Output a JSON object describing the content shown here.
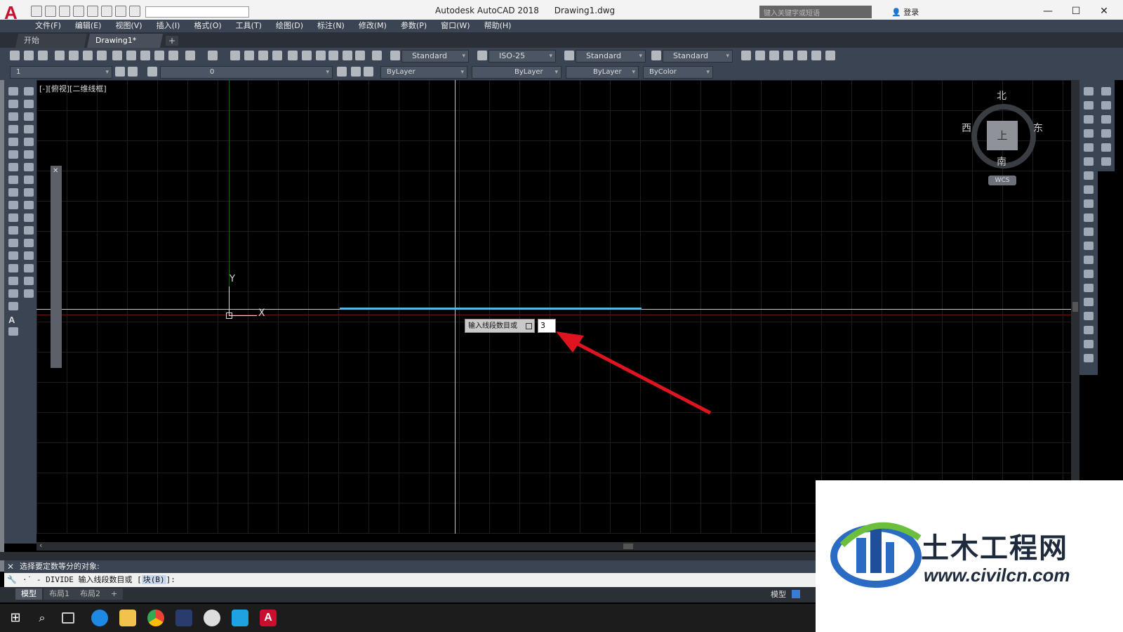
{
  "titlebar": {
    "app_logo": "A",
    "app_name": "Autodesk AutoCAD 2018",
    "doc_name": "Drawing1.dwg",
    "search_placeholder": "键入关键字或短语",
    "login_label": "登录",
    "minimize": "—",
    "maximize": "☐",
    "close": "✕"
  },
  "menu": {
    "items": [
      "文件(F)",
      "编辑(E)",
      "视图(V)",
      "插入(I)",
      "格式(O)",
      "工具(T)",
      "绘图(D)",
      "标注(N)",
      "修改(M)",
      "参数(P)",
      "窗口(W)",
      "帮助(H)"
    ]
  },
  "filetabs": {
    "start_label": "开始",
    "doc_label": "Drawing1*",
    "close_glyph": "×",
    "add_glyph": "+"
  },
  "toolbar": {
    "text_style": "Standard",
    "dim_style": "ISO-25",
    "table_style": "Standard",
    "mleader_style": "Standard",
    "workspace_value": "1",
    "layer_value": "0",
    "color_value": "ByLayer",
    "linetype_value": "ByLayer",
    "lineweight_value": "ByLayer",
    "plotstyle_value": "ByColor"
  },
  "canvas": {
    "view_label": "[-][俯视][二维线框]",
    "ucs_y": "Y",
    "ucs_x": "X",
    "drawn_line_color": "#5ab4e6"
  },
  "dynamic_input": {
    "prompt": "输入线段数目或",
    "value": "3"
  },
  "viewcube": {
    "north": "北",
    "south": "南",
    "west": "西",
    "east": "东",
    "face": "上",
    "wcs": "WCS"
  },
  "command": {
    "history": "选择要定数等分的对象:",
    "prefix": "·˙ -",
    "current_cmd": "DIVIDE 输入线段数目或 [",
    "option": "块(B)",
    "suffix": "]:"
  },
  "layout_tabs": {
    "model": "模型",
    "layout1": "布局1",
    "layout2": "布局2",
    "add": "+"
  },
  "statusbar": {
    "model_label": "模型"
  },
  "watermark": {
    "name": "土木工程网",
    "url": "www.civilcn.com"
  }
}
